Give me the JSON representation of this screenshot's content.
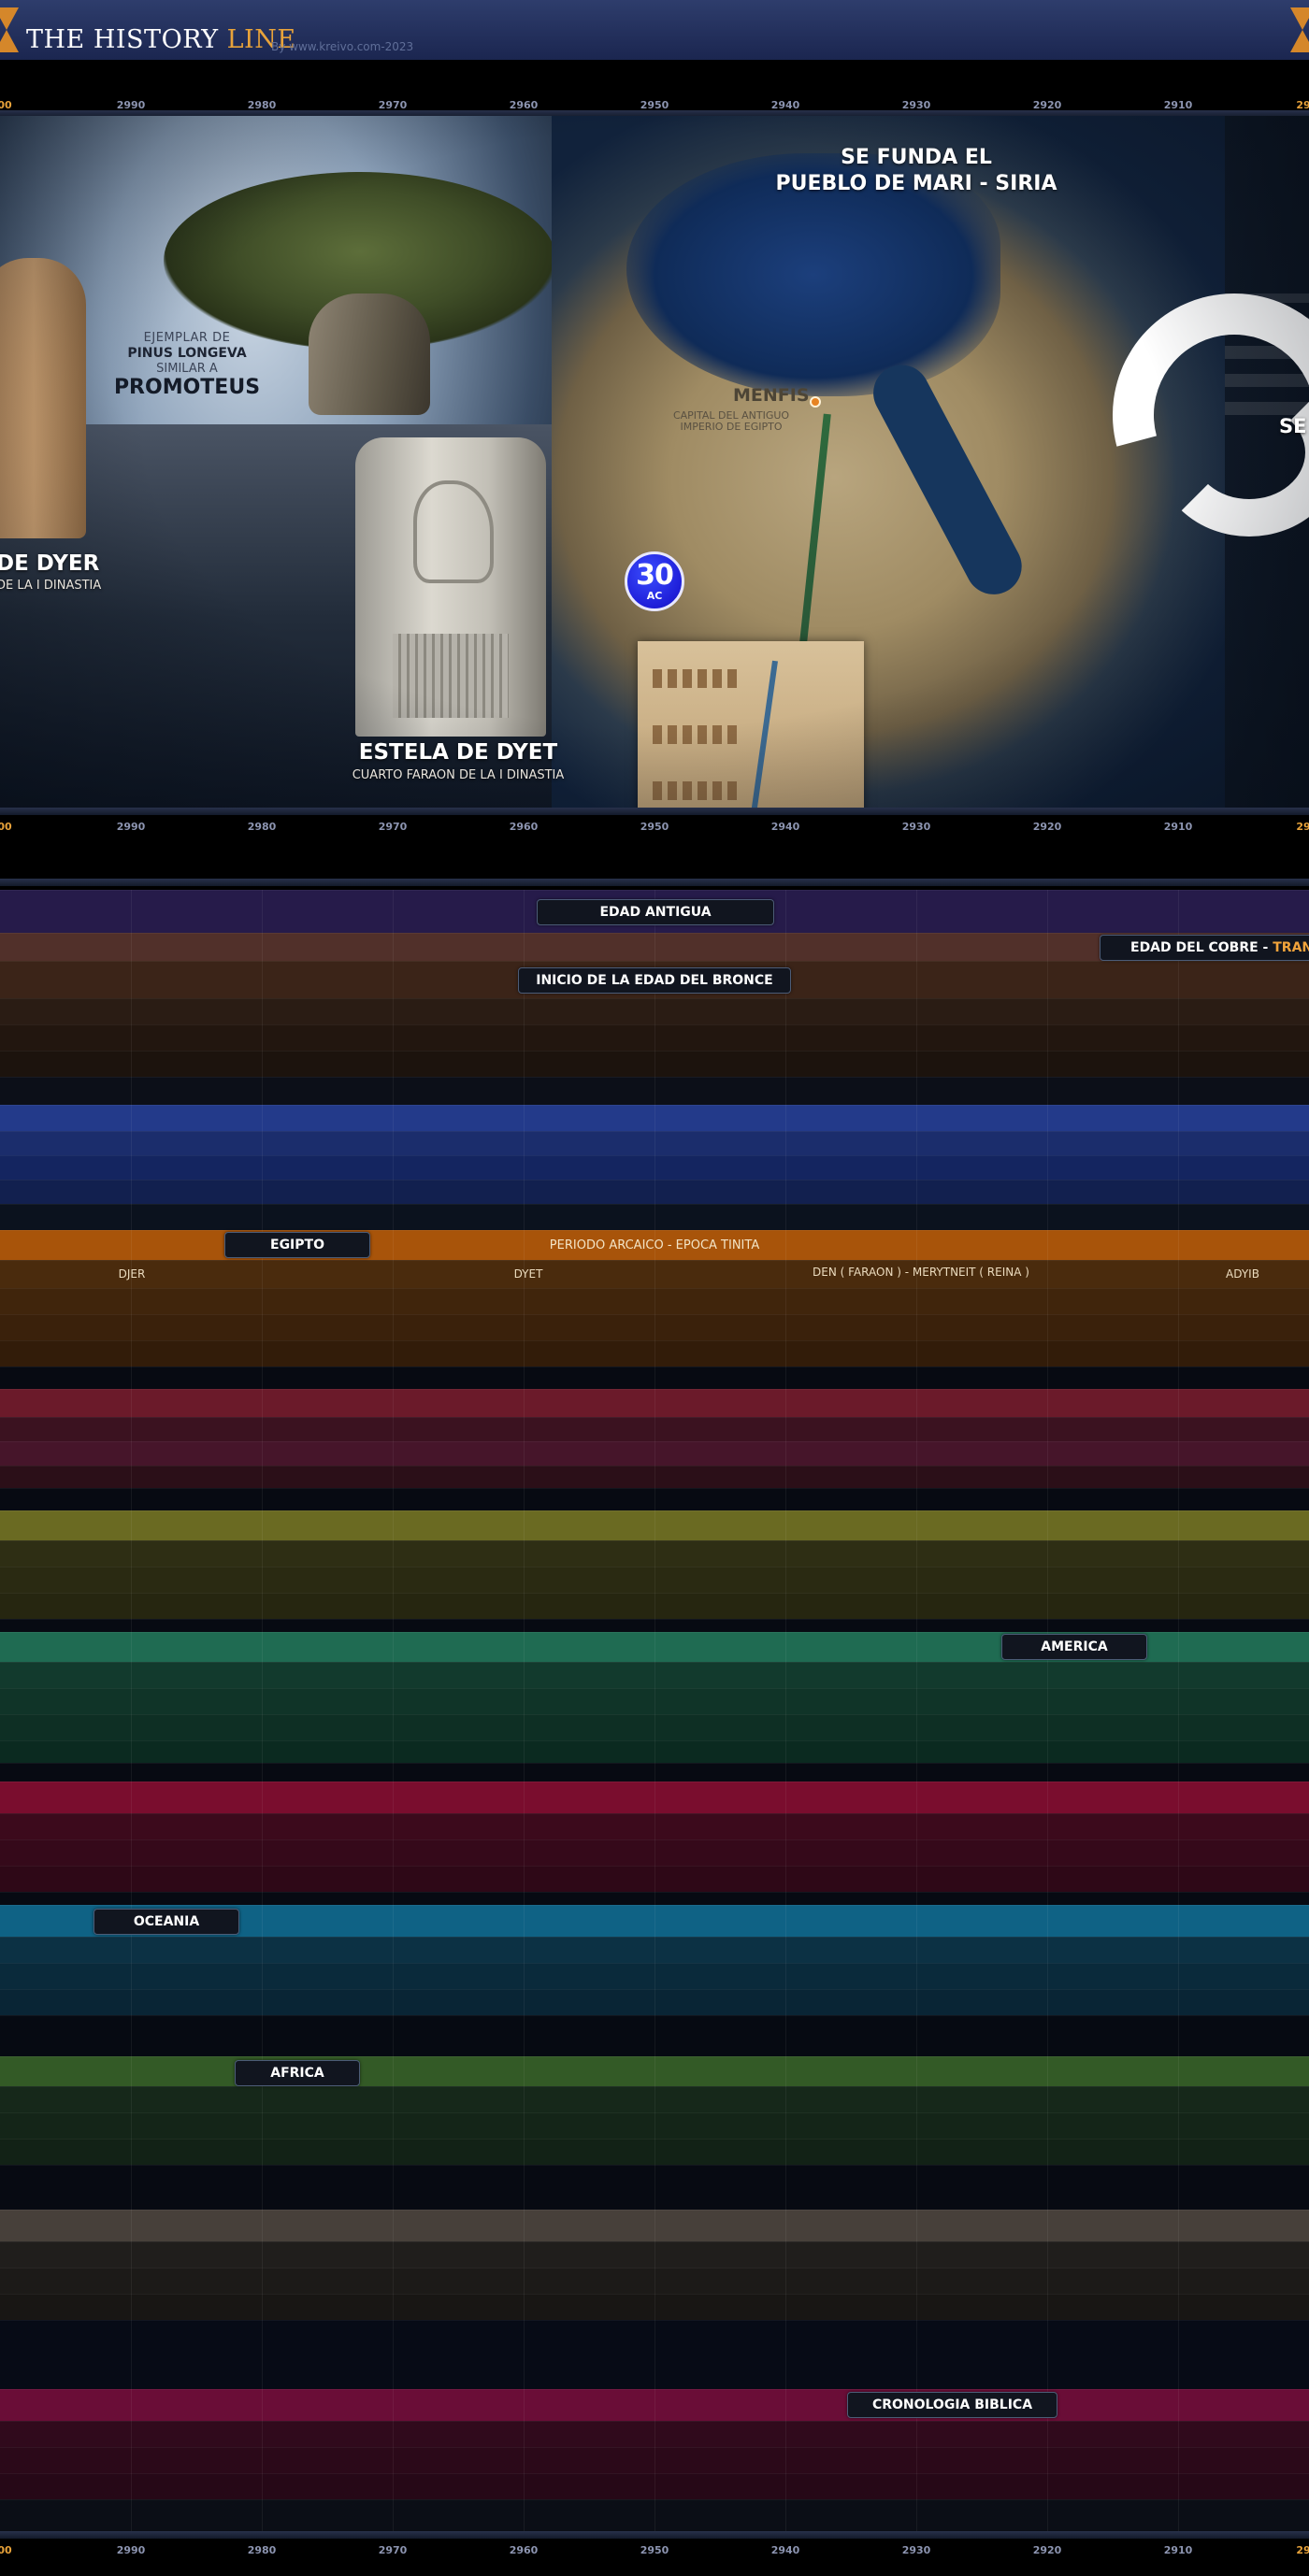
{
  "header": {
    "brand_main": "THE HISTORY ",
    "brand_accent": "LINE",
    "credit": "By www.kreivo.com-2023",
    "colors": {
      "brand_accent": "#e8a33a",
      "background": "#2e3d6c"
    }
  },
  "axis": {
    "left_edge": "00",
    "right_edge": "29",
    "labels": [
      "2990",
      "2980",
      "2970",
      "2960",
      "2950",
      "2940",
      "2930",
      "2920",
      "2910"
    ]
  },
  "hero": {
    "badge_number": "30",
    "badge_unit": "AC",
    "tree_caption": {
      "line1": "EJEMPLAR DE",
      "line2": "PINUS LONGEVA",
      "line3": "SIMILAR A",
      "line4": "PROMOTEUS"
    },
    "left_stela": {
      "title": "DE DYER",
      "subtitle": "DE LA I DINASTIA"
    },
    "stela": {
      "title": "ESTELA DE DYET",
      "subtitle": "CUARTO FARAON DE LA I DINASTIA"
    },
    "mari": {
      "line1": "SE FUNDA EL",
      "line2": "PUEBLO DE MARI - SIRIA"
    },
    "menfis": {
      "title": "MENFIS",
      "line1": "CAPITAL DEL ANTIGUO",
      "line2": "IMPERIO DE EGIPTO"
    },
    "right_cut": "SE"
  },
  "timeline": {
    "edad_antigua": "EDAD ANTIGUA",
    "edad_cobre": "EDAD DEL COBRE",
    "edad_cobre_sep": " - ",
    "edad_cobre_acc": "TRANSI",
    "bronce": "INICIO DE LA EDAD DEL BRONCE",
    "egipto": "EGIPTO",
    "egipto_period": "PERIODO ARCAICO  -  EPOCA TINITA",
    "rulers": [
      {
        "name": "DJER"
      },
      {
        "name": "DYET"
      },
      {
        "name": "DEN ( FARAON )  -  MERYTNEIT ( REINA )"
      },
      {
        "name": "ADYIB"
      }
    ],
    "america": "AMERICA",
    "oceania": "OCEANIA",
    "africa": "AFRICA",
    "biblica": "CRONOLOGIA BIBLICA"
  }
}
